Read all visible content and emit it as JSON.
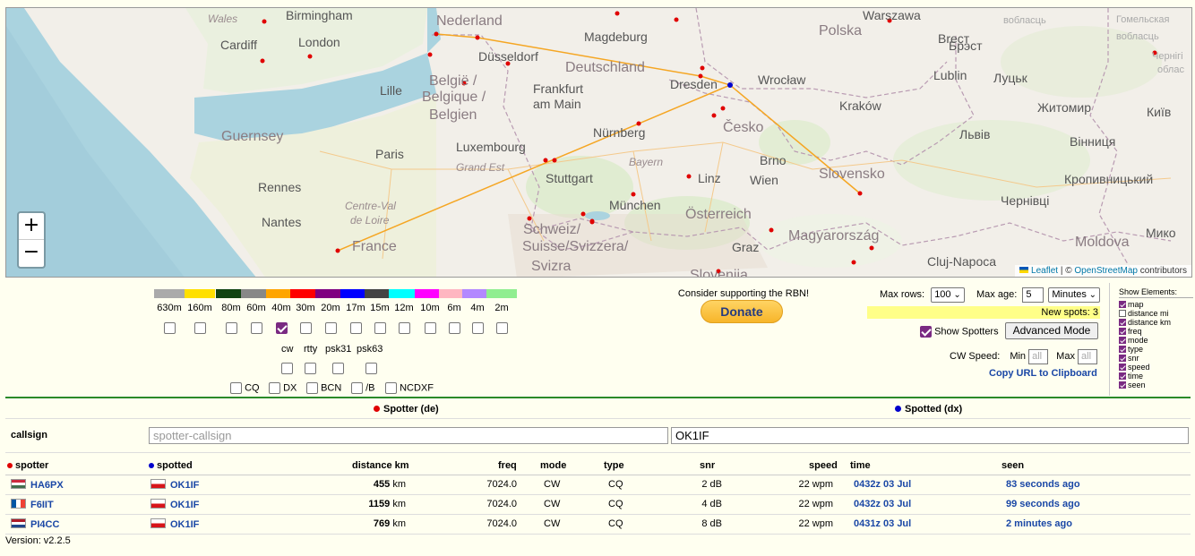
{
  "map": {
    "labels": [
      {
        "t": "Birmingham",
        "c": ""
      },
      {
        "t": "Wales",
        "c": "italic"
      },
      {
        "t": "Cardiff",
        "c": ""
      },
      {
        "t": "London",
        "c": ""
      },
      {
        "t": "Nederland",
        "c": "country"
      },
      {
        "t": "Magdeburg",
        "c": ""
      },
      {
        "t": "Polska",
        "c": "country"
      },
      {
        "t": "Warszawa",
        "c": ""
      },
      {
        "t": "Düsseldorf",
        "c": ""
      },
      {
        "t": "Deutschland",
        "c": "country"
      },
      {
        "t": "België /",
        "c": "country"
      },
      {
        "t": "Belgique /",
        "c": "country"
      },
      {
        "t": "Belgien",
        "c": "country"
      },
      {
        "t": "Lille",
        "c": ""
      },
      {
        "t": "Frankfurt",
        "c": ""
      },
      {
        "t": "am Main",
        "c": ""
      },
      {
        "t": "Dresden",
        "c": ""
      },
      {
        "t": "Wrocław",
        "c": ""
      },
      {
        "t": "Lublin",
        "c": ""
      },
      {
        "t": "Brест",
        "c": ""
      },
      {
        "t": "Луцьк",
        "c": ""
      },
      {
        "t": "Kraków",
        "c": ""
      },
      {
        "t": "Житомир",
        "c": ""
      },
      {
        "t": "Київ",
        "c": ""
      },
      {
        "t": "Guernsey",
        "c": "country"
      },
      {
        "t": "Paris",
        "c": ""
      },
      {
        "t": "Luxembourg",
        "c": ""
      },
      {
        "t": "Nürnberg",
        "c": ""
      },
      {
        "t": "Česko",
        "c": "country"
      },
      {
        "t": "Львів",
        "c": ""
      },
      {
        "t": "Вінниця",
        "c": ""
      },
      {
        "t": "Grand Est",
        "c": "italic"
      },
      {
        "t": "Bayern",
        "c": "italic"
      },
      {
        "t": "Brno",
        "c": ""
      },
      {
        "t": "Slovensko",
        "c": "country"
      },
      {
        "t": "Rennes",
        "c": ""
      },
      {
        "t": "Stuttgart",
        "c": ""
      },
      {
        "t": "Linz",
        "c": ""
      },
      {
        "t": "Wien",
        "c": ""
      },
      {
        "t": "Кропивницький",
        "c": ""
      },
      {
        "t": "Чернівці",
        "c": ""
      },
      {
        "t": "Centre-Val",
        "c": "italic"
      },
      {
        "t": "de Loire",
        "c": "italic"
      },
      {
        "t": "Nantes",
        "c": ""
      },
      {
        "t": "München",
        "c": ""
      },
      {
        "t": "Österreich",
        "c": "country"
      },
      {
        "t": "Schweiz/",
        "c": "country"
      },
      {
        "t": "Suisse/Svizzera/",
        "c": "country"
      },
      {
        "t": "Svizra",
        "c": "country"
      },
      {
        "t": "France",
        "c": "country"
      },
      {
        "t": "Graz",
        "c": ""
      },
      {
        "t": "Magyarország",
        "c": "country"
      },
      {
        "t": "Moldova",
        "c": "country"
      },
      {
        "t": "Cluj-Napoca",
        "c": ""
      },
      {
        "t": "Slovenija",
        "c": "country"
      },
      {
        "t": "Мико",
        "c": ""
      },
      {
        "t": "Брэст",
        "c": ""
      },
      {
        "t": "вобласць",
        "c": "tiny"
      },
      {
        "t": "Гомельская",
        "c": "tiny"
      },
      {
        "t": "вобласць",
        "c": "tiny"
      },
      {
        "t": "Чернігі",
        "c": "tiny"
      },
      {
        "t": "облас",
        "c": "tiny"
      }
    ],
    "zoom_in": "+",
    "zoom_out": "−",
    "attribution_leaflet": "Leaflet",
    "attribution_sep": " | © ",
    "attribution_osm": "OpenStreetMap",
    "attribution_tail": " contributors",
    "colors": {
      "path": "#f5a623",
      "spotter_dot": "#e00000",
      "dx_dot": "#0000cc"
    }
  },
  "bands": [
    {
      "name": "630m",
      "color": "#aaaaaa",
      "checked": false
    },
    {
      "name": "160m",
      "color": "#ffe000",
      "checked": false
    },
    {
      "name": "80m",
      "color": "#114411",
      "checked": false
    },
    {
      "name": "60m",
      "color": "#888888",
      "checked": false
    },
    {
      "name": "40m",
      "color": "#ffa500",
      "checked": true
    },
    {
      "name": "30m",
      "color": "#ff0000",
      "checked": false
    },
    {
      "name": "20m",
      "color": "#800080",
      "checked": false
    },
    {
      "name": "17m",
      "color": "#0000ff",
      "checked": false
    },
    {
      "name": "15m",
      "color": "#444444",
      "checked": false
    },
    {
      "name": "12m",
      "color": "#00ffff",
      "checked": false
    },
    {
      "name": "10m",
      "color": "#ff00ff",
      "checked": false
    },
    {
      "name": "6m",
      "color": "#ffb6c1",
      "checked": false
    },
    {
      "name": "4m",
      "color": "#b388ff",
      "checked": false
    },
    {
      "name": "2m",
      "color": "#90ee90",
      "checked": false
    }
  ],
  "modes": [
    "cw",
    "rtty",
    "psk31",
    "psk63"
  ],
  "types": [
    "CQ",
    "DX",
    "BCN",
    "/B",
    "NCDXF"
  ],
  "support_text": "Consider supporting the RBN!",
  "donate_label": "Donate",
  "max_rows_label": "Max rows:",
  "max_rows_value": "100",
  "max_age_label": "Max age:",
  "max_age_value": "5",
  "max_age_unit": "Minutes",
  "new_spots": "New spots: 3",
  "show_spotters_label": "Show Spotters",
  "advanced_mode_label": "Advanced Mode",
  "cw_speed_label": "CW Speed:",
  "cw_min_label": "Min",
  "cw_max_label": "Max",
  "cw_min_placeholder": "all",
  "cw_max_placeholder": "all",
  "copy_url_label": "Copy URL to Clipboard",
  "show_elements": {
    "title": "Show Elements:",
    "items": [
      {
        "label": "map",
        "on": true
      },
      {
        "label": "distance mi",
        "on": false
      },
      {
        "label": "distance km",
        "on": true
      },
      {
        "label": "freq",
        "on": true
      },
      {
        "label": "mode",
        "on": true
      },
      {
        "label": "type",
        "on": true
      },
      {
        "label": "snr",
        "on": true
      },
      {
        "label": "speed",
        "on": true
      },
      {
        "label": "time",
        "on": true
      },
      {
        "label": "seen",
        "on": true
      }
    ]
  },
  "filter": {
    "spotter_header": "Spotter (de)",
    "spotted_header": "Spotted (dx)",
    "callsign_label": "callsign",
    "spotter_placeholder": "spotter-callsign",
    "spotted_value": "OK1IF"
  },
  "table": {
    "headers": {
      "spotter": "spotter",
      "spotted": "spotted",
      "distance": "distance km",
      "freq": "freq",
      "mode": "mode",
      "type": "type",
      "snr": "snr",
      "speed": "speed",
      "time": "time",
      "seen": "seen"
    },
    "rows": [
      {
        "spotter": "HA6PX",
        "spotter_flag": "hu",
        "spotted": "OK1IF",
        "spotted_flag": "cz",
        "distance": "455",
        "dist_unit": "km",
        "freq": "7024.0",
        "mode": "CW",
        "type": "CQ",
        "snr": "2 dB",
        "speed": "22 wpm",
        "time": "0432z 03 Jul",
        "seen": "83 seconds ago"
      },
      {
        "spotter": "F6IIT",
        "spotter_flag": "fr",
        "spotted": "OK1IF",
        "spotted_flag": "cz",
        "distance": "1159",
        "dist_unit": "km",
        "freq": "7024.0",
        "mode": "CW",
        "type": "CQ",
        "snr": "4 dB",
        "speed": "22 wpm",
        "time": "0432z 03 Jul",
        "seen": "99 seconds ago"
      },
      {
        "spotter": "PI4CC",
        "spotter_flag": "nl",
        "spotted": "OK1IF",
        "spotted_flag": "cz",
        "distance": "769",
        "dist_unit": "km",
        "freq": "7024.0",
        "mode": "CW",
        "type": "CQ",
        "snr": "8 dB",
        "speed": "22 wpm",
        "time": "0431z 03 Jul",
        "seen": "2 minutes ago"
      }
    ]
  },
  "version": "Version: v2.2.5"
}
